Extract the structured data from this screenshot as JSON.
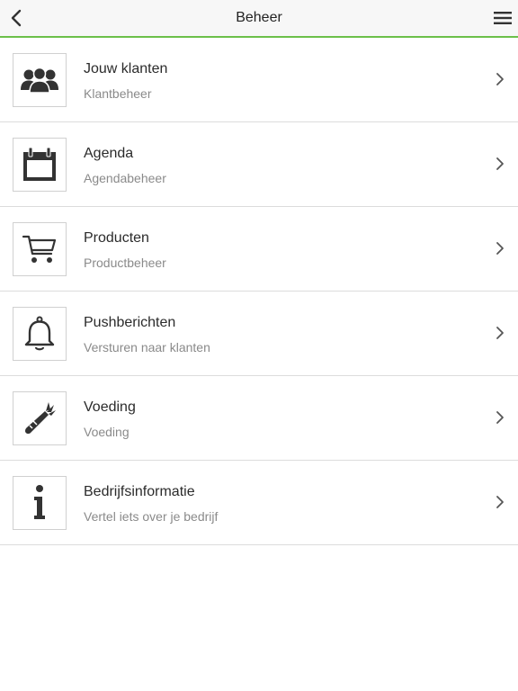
{
  "header": {
    "title": "Beheer",
    "back_icon": "chevron-left-icon",
    "menu_icon": "hamburger-menu-icon",
    "accent_color": "#6cc04a"
  },
  "items": [
    {
      "title": "Jouw klanten",
      "subtitle": "Klantbeheer",
      "icon": "users-icon"
    },
    {
      "title": "Agenda",
      "subtitle": "Agendabeheer",
      "icon": "calendar-icon"
    },
    {
      "title": "Producten",
      "subtitle": "Productbeheer",
      "icon": "shopping-cart-icon"
    },
    {
      "title": "Pushberichten",
      "subtitle": "Versturen naar klanten",
      "icon": "bell-icon"
    },
    {
      "title": "Voeding",
      "subtitle": "Voeding",
      "icon": "carrot-icon"
    },
    {
      "title": "Bedrijfsinformatie",
      "subtitle": "Vertel iets over je bedrijf",
      "icon": "info-icon"
    }
  ]
}
